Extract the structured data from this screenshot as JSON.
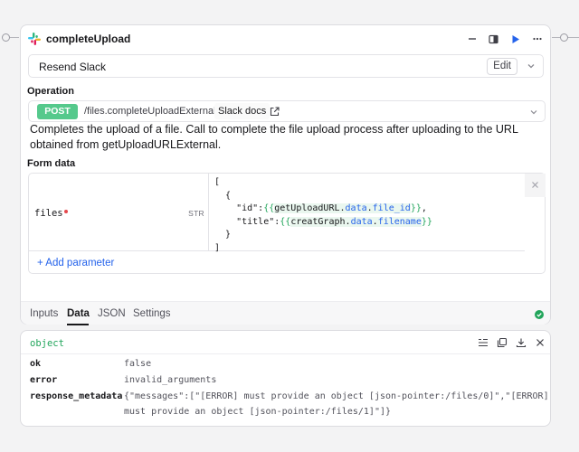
{
  "node": {
    "title": "completeUpload",
    "resource": "Resend Slack",
    "edit_label": "Edit",
    "operation_label": "Operation",
    "method": "POST",
    "path": "/files.completeUploadExternal",
    "docs_label": "Slack docs",
    "description": "Completes the upload of a file. Call to complete the file upload process after uploading to the URL obtained from getUploadURLExternal.",
    "form_label": "Form data",
    "param_key": "files",
    "param_type": "STR",
    "add_param_label": "+ Add parameter",
    "code": {
      "open_bracket": "[",
      "open_brace": "{",
      "id_key": "\"id\":",
      "id_var": "getUploadURL",
      "id_dot1": ".",
      "id_prop1": "data",
      "id_dot2": ".",
      "id_prop2": "file_id",
      "id_tail": ",",
      "title_key": "\"title\":",
      "title_var": "creatGraph",
      "title_dot1": ".",
      "title_prop1": "data",
      "title_dot2": ".",
      "title_prop2": "filename",
      "close_brace": "}",
      "close_bracket": "]",
      "tpl_open": "{{",
      "tpl_close": "}}"
    },
    "tabs": [
      {
        "label": "Inputs"
      },
      {
        "label": "Data"
      },
      {
        "label": "JSON"
      },
      {
        "label": "Settings"
      }
    ],
    "active_tab": "Data"
  },
  "result": {
    "type_label": "object",
    "rows": [
      {
        "key": "ok",
        "value": "false"
      },
      {
        "key": "error",
        "value": "invalid_arguments"
      },
      {
        "key": "response_metadata",
        "value_line1": "{\"messages\":[\"[ERROR] must provide an object [json-pointer:/files/0]\",\"[ERROR]",
        "value_line2": "must provide an object [json-pointer:/files/1]\"]}"
      }
    ]
  },
  "colors": {
    "post_badge": "#55c98c",
    "link": "#2563eb",
    "template_brace": "#22a55b",
    "status_ok": "#22a55b"
  },
  "icons": [
    "slack-logo-icon",
    "minus-icon",
    "panel-icon",
    "play-icon",
    "more-icon",
    "chevron-down-icon",
    "external-link-icon",
    "close-icon",
    "check-circle-icon",
    "list-icon",
    "copy-icon",
    "download-icon"
  ]
}
